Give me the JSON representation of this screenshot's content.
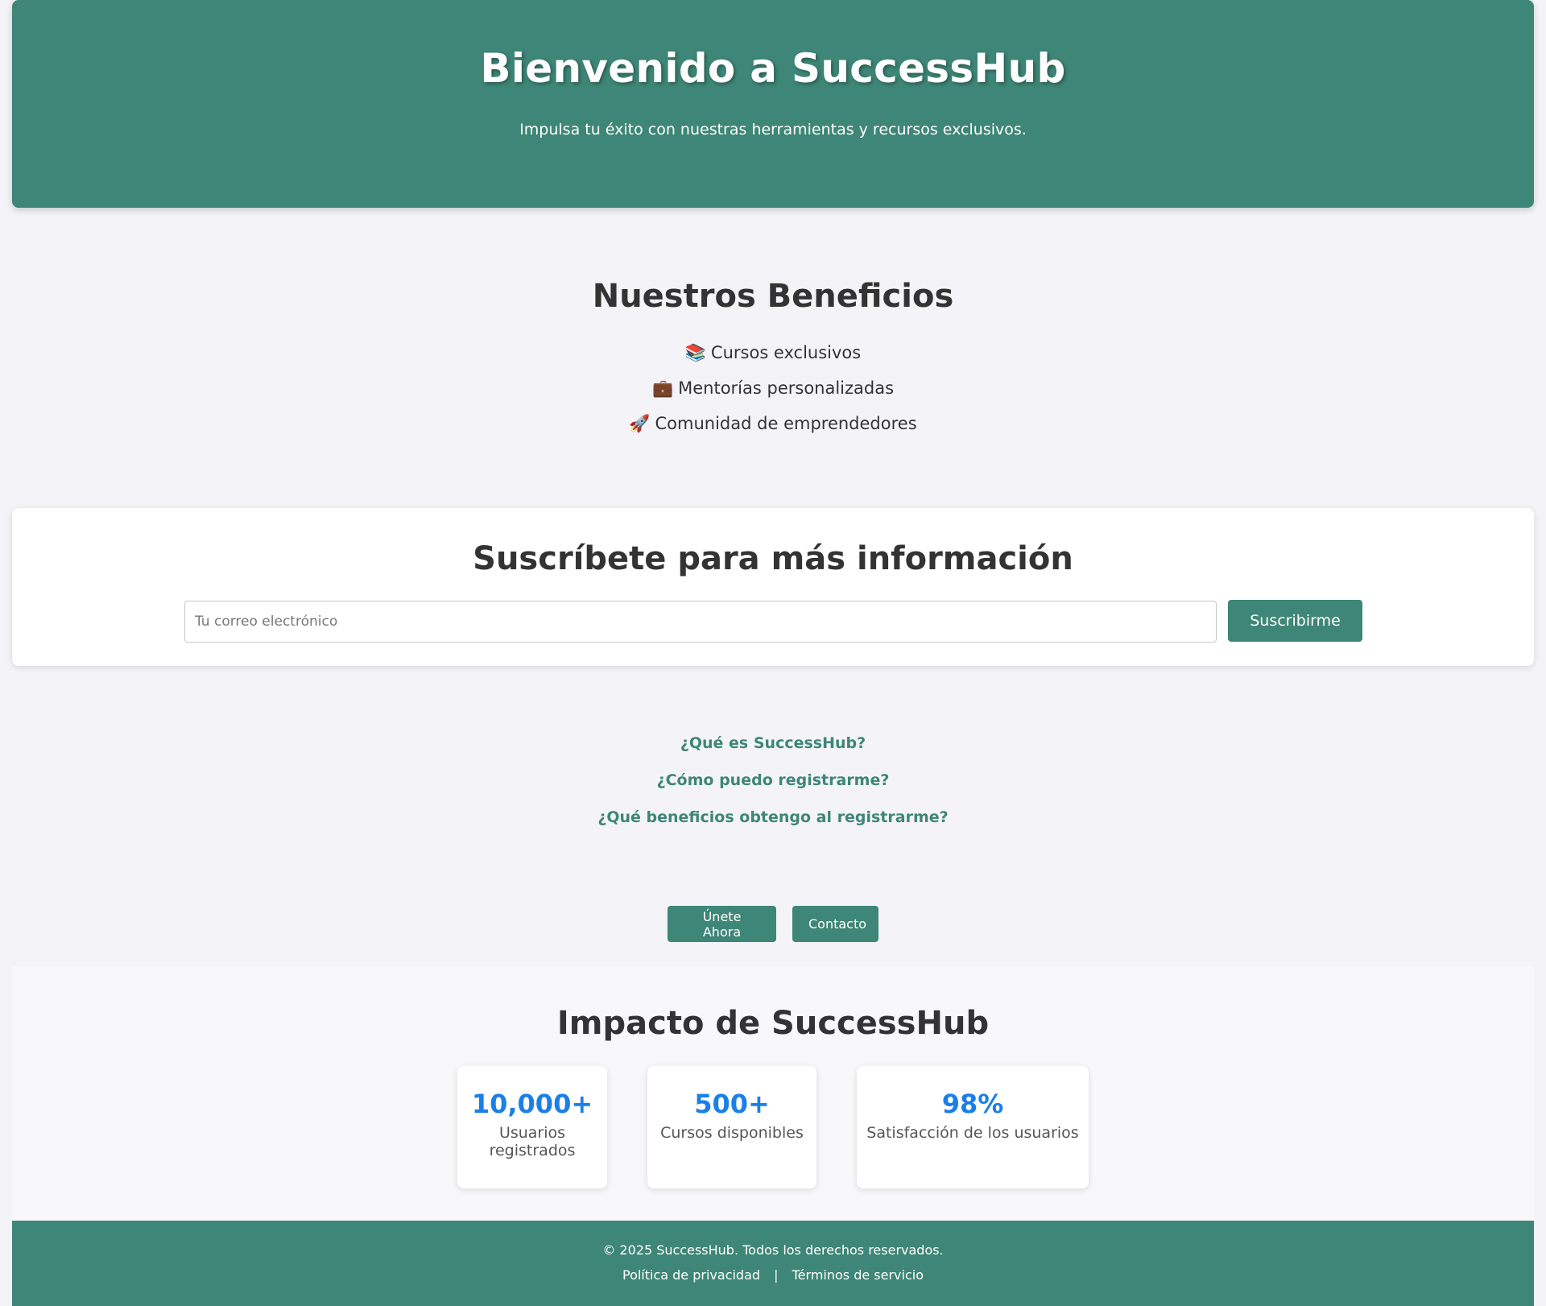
{
  "hero": {
    "title": "Bienvenido a SuccessHub",
    "subtitle": "Impulsa tu éxito con nuestras herramientas y recursos exclusivos.",
    "background_color": "#3e8677"
  },
  "benefits": {
    "title": "Nuestros Beneficios",
    "items": [
      {
        "emoji": "📚",
        "label": "Cursos exclusivos",
        "icon": "books-icon"
      },
      {
        "emoji": "💼",
        "label": "Mentorías personalizadas",
        "icon": "briefcase-icon"
      },
      {
        "emoji": "🚀",
        "label": "Comunidad de emprendedores",
        "icon": "rocket-icon"
      }
    ]
  },
  "subscribe": {
    "title": "Suscríbete para más información",
    "email_placeholder": "Tu correo electrónico",
    "email_value": "",
    "button_label": "Suscribirme"
  },
  "faq": {
    "items": [
      "¿Qué es SuccessHub?",
      "¿Cómo puedo registrarme?",
      "¿Qué beneficios obtengo al registrarme?"
    ]
  },
  "cta": {
    "join_label": "Únete Ahora",
    "contact_label": "Contacto"
  },
  "impact": {
    "title": "Impacto de SuccessHub",
    "stats": [
      {
        "value": "10,000+",
        "label": "Usuarios registrados"
      },
      {
        "value": "500+",
        "label": "Cursos disponibles"
      },
      {
        "value": "98%",
        "label": "Satisfacción de los usuarios"
      }
    ],
    "value_color": "#1a7fe8"
  },
  "footer": {
    "copyright": "© 2025 SuccessHub. Todos los derechos reservados.",
    "privacy_label": "Política de privacidad",
    "separator": "|",
    "terms_label": "Términos de servicio"
  },
  "colors": {
    "accent": "#3e8677",
    "page_background": "#f4f4f8"
  }
}
